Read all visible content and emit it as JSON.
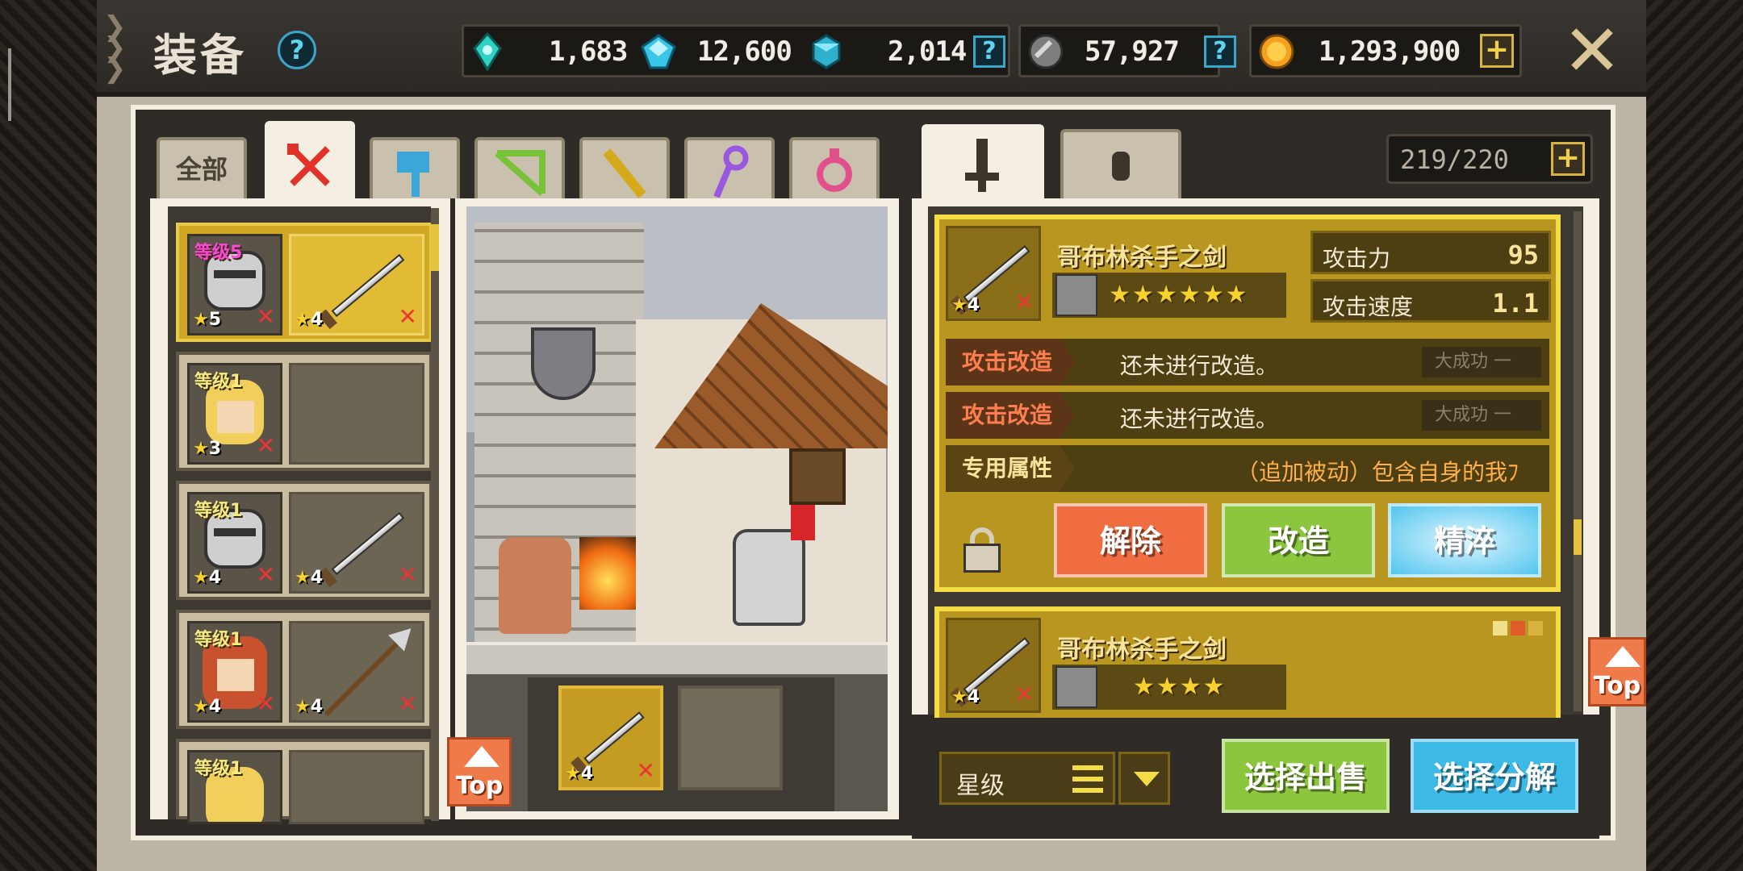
{
  "header": {
    "title": "装备",
    "help": "?",
    "resources": [
      {
        "icon": "teal-crystal-icon",
        "value": "1,683"
      },
      {
        "icon": "blue-gem-icon",
        "value": "12,600"
      },
      {
        "icon": "cyan-gem-icon",
        "value": "2,014",
        "action": "?"
      },
      {
        "icon": "iron-ore-icon",
        "value": "57,927",
        "action": "?"
      },
      {
        "icon": "gold-coin-icon",
        "value": "1,293,900",
        "action": "+"
      }
    ],
    "close": "✕"
  },
  "category_tabs": [
    {
      "label": "全部",
      "icon": "all"
    },
    {
      "label": "",
      "icon": "sword-icon",
      "color": "#e0322a",
      "active": true
    },
    {
      "label": "",
      "icon": "hammer-icon",
      "color": "#3aa7d8"
    },
    {
      "label": "",
      "icon": "bow-icon",
      "color": "#7ac13a"
    },
    {
      "label": "",
      "icon": "gun-icon",
      "color": "#d4a91c"
    },
    {
      "label": "",
      "icon": "staff-icon",
      "color": "#9a58e0"
    },
    {
      "label": "",
      "icon": "amulet-icon",
      "color": "#e0508a"
    }
  ],
  "heroes": [
    {
      "level": "等级5",
      "stars": "5",
      "weapon_stars": "4",
      "weapon": "sword",
      "selected": true,
      "level_color": "pink"
    },
    {
      "level": "等级1",
      "stars": "3",
      "weapon_stars": "",
      "weapon": "none"
    },
    {
      "level": "等级1",
      "stars": "4",
      "weapon_stars": "4",
      "weapon": "sword"
    },
    {
      "level": "等级1",
      "stars": "4",
      "weapon_stars": "4",
      "weapon": "spear"
    },
    {
      "level": "等级1",
      "stars": "",
      "weapon_stars": "",
      "weapon": "none"
    }
  ],
  "scene": {
    "equipped_slot_stars": "4",
    "top_label": "Top"
  },
  "right_tabs": [
    {
      "icon": "sword-upright-icon",
      "active": true
    },
    {
      "icon": "crossed-icon"
    }
  ],
  "capacity": {
    "value": "219/220",
    "action": "+"
  },
  "selected_item": {
    "name": "哥布林杀手之剑",
    "stars": "4",
    "owner_stars": "★★★★★★",
    "stats": [
      {
        "label": "攻击力",
        "value": "95"
      },
      {
        "label": "攻击速度",
        "value": "1.1"
      }
    ],
    "mods": [
      {
        "label": "攻击改造",
        "text": "还未进行改造。",
        "tag": "大成功 一"
      },
      {
        "label": "攻击改造",
        "text": "还未进行改造。",
        "tag": "大成功 一"
      },
      {
        "label": "专用属性",
        "text": "（追加被动）包含自身的我ﾌ"
      }
    ],
    "buttons": {
      "release": "解除",
      "reform": "改造",
      "refine": "精淬"
    }
  },
  "second_item": {
    "name": "哥布林杀手之剑",
    "stars": "4",
    "owner_stars": "★★★★"
  },
  "right_top_label": "Top",
  "bottom": {
    "sort_label": "星级",
    "sell": "选择出售",
    "dismantle": "选择分解"
  }
}
